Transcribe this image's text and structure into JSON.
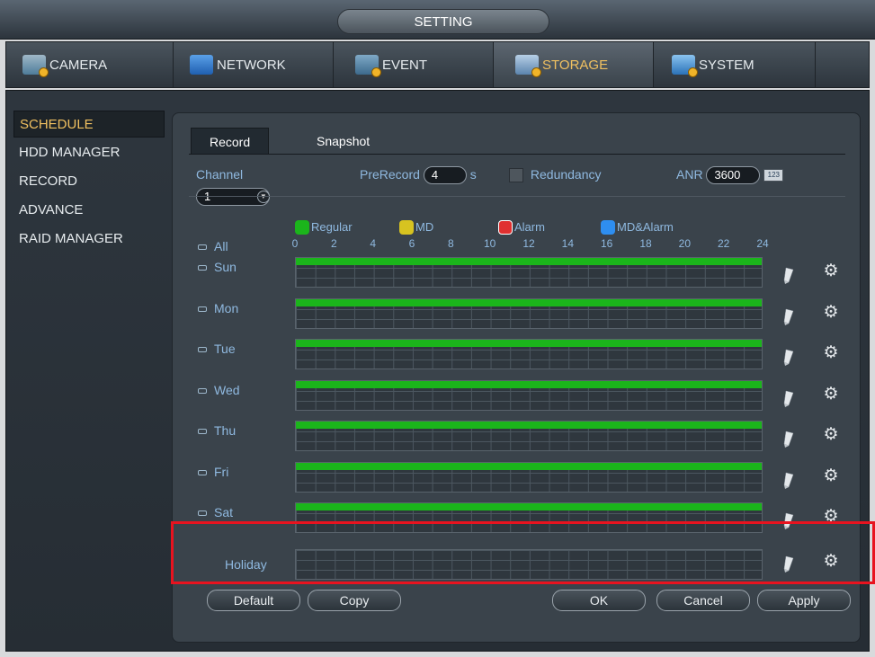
{
  "window": {
    "title": "SETTING"
  },
  "tabs": [
    {
      "label": "CAMERA",
      "icon": "camera-icon"
    },
    {
      "label": "NETWORK",
      "icon": "network-icon"
    },
    {
      "label": "EVENT",
      "icon": "event-icon"
    },
    {
      "label": "STORAGE",
      "icon": "storage-icon",
      "active": true
    },
    {
      "label": "SYSTEM",
      "icon": "system-icon"
    }
  ],
  "sidebar": {
    "items": [
      {
        "label": "SCHEDULE",
        "active": true
      },
      {
        "label": "HDD MANAGER"
      },
      {
        "label": "RECORD"
      },
      {
        "label": "ADVANCE"
      },
      {
        "label": "RAID MANAGER"
      }
    ]
  },
  "subtabs": [
    {
      "label": "Record",
      "active": true
    },
    {
      "label": "Snapshot"
    }
  ],
  "settings": {
    "channel_label": "Channel",
    "channel_value": "1",
    "prerecord_label": "PreRecord",
    "prerecord_value": "4",
    "prerecord_unit": "s",
    "redundancy_label": "Redundancy",
    "anr_label": "ANR",
    "anr_value": "3600",
    "keyboard_icon_text": "123"
  },
  "legend": [
    {
      "label": "Regular",
      "color": "#1bb51b"
    },
    {
      "label": "MD",
      "color": "#d7c320"
    },
    {
      "label": "Alarm",
      "color": "#e03030"
    },
    {
      "label": "MD&Alarm",
      "color": "#2e8ef0"
    }
  ],
  "hours": [
    "0",
    "2",
    "4",
    "6",
    "8",
    "10",
    "12",
    "14",
    "16",
    "18",
    "20",
    "22",
    "24"
  ],
  "all_label": "All",
  "days": [
    {
      "label": "Sun",
      "regular_fraction": 1.0
    },
    {
      "label": "Mon",
      "regular_fraction": 1.0
    },
    {
      "label": "Tue",
      "regular_fraction": 1.0
    },
    {
      "label": "Wed",
      "regular_fraction": 1.0
    },
    {
      "label": "Thu",
      "regular_fraction": 1.0
    },
    {
      "label": "Fri",
      "regular_fraction": 1.0
    },
    {
      "label": "Sat",
      "regular_fraction": 1.0
    },
    {
      "label": "Holiday",
      "regular_fraction": 0.0
    }
  ],
  "buttons": {
    "default": "Default",
    "copy": "Copy",
    "ok": "OK",
    "cancel": "Cancel",
    "apply": "Apply"
  },
  "colors": {
    "accent": "#f0c060",
    "highlight": "#e8131f"
  }
}
